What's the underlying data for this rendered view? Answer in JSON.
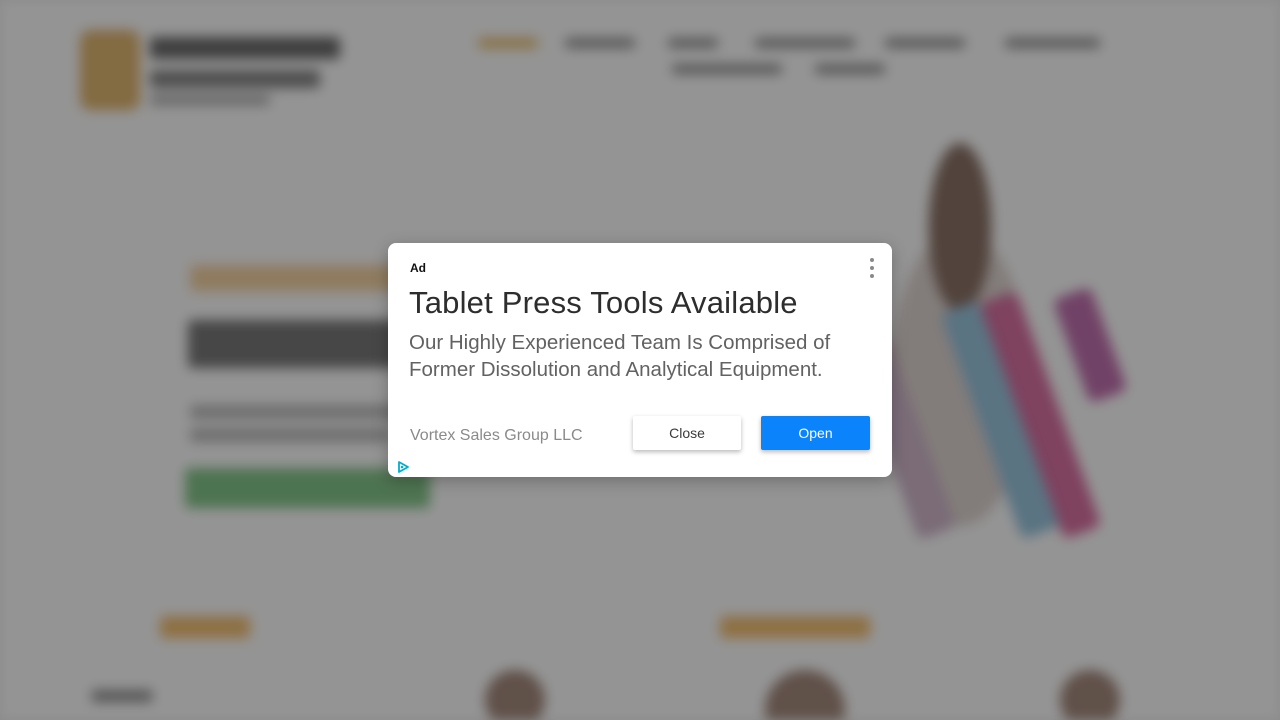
{
  "ad": {
    "label": "Ad",
    "headline": "Tablet Press Tools Available",
    "body": "Our Highly Experienced Team Is Comprised of Former Dissolution and Analytical Equipment.",
    "advertiser": "Vortex Sales Group LLC",
    "close_label": "Close",
    "open_label": "Open",
    "menu_icon": "more-vert-icon",
    "adchoices_icon": "adchoices-icon"
  },
  "background": {
    "sidebar_label": "WOMEN",
    "sidebar_toggle": "+"
  },
  "colors": {
    "open_button": "#0b83fb",
    "adchoices": "#00aecd",
    "accent": "#e1ad48"
  }
}
